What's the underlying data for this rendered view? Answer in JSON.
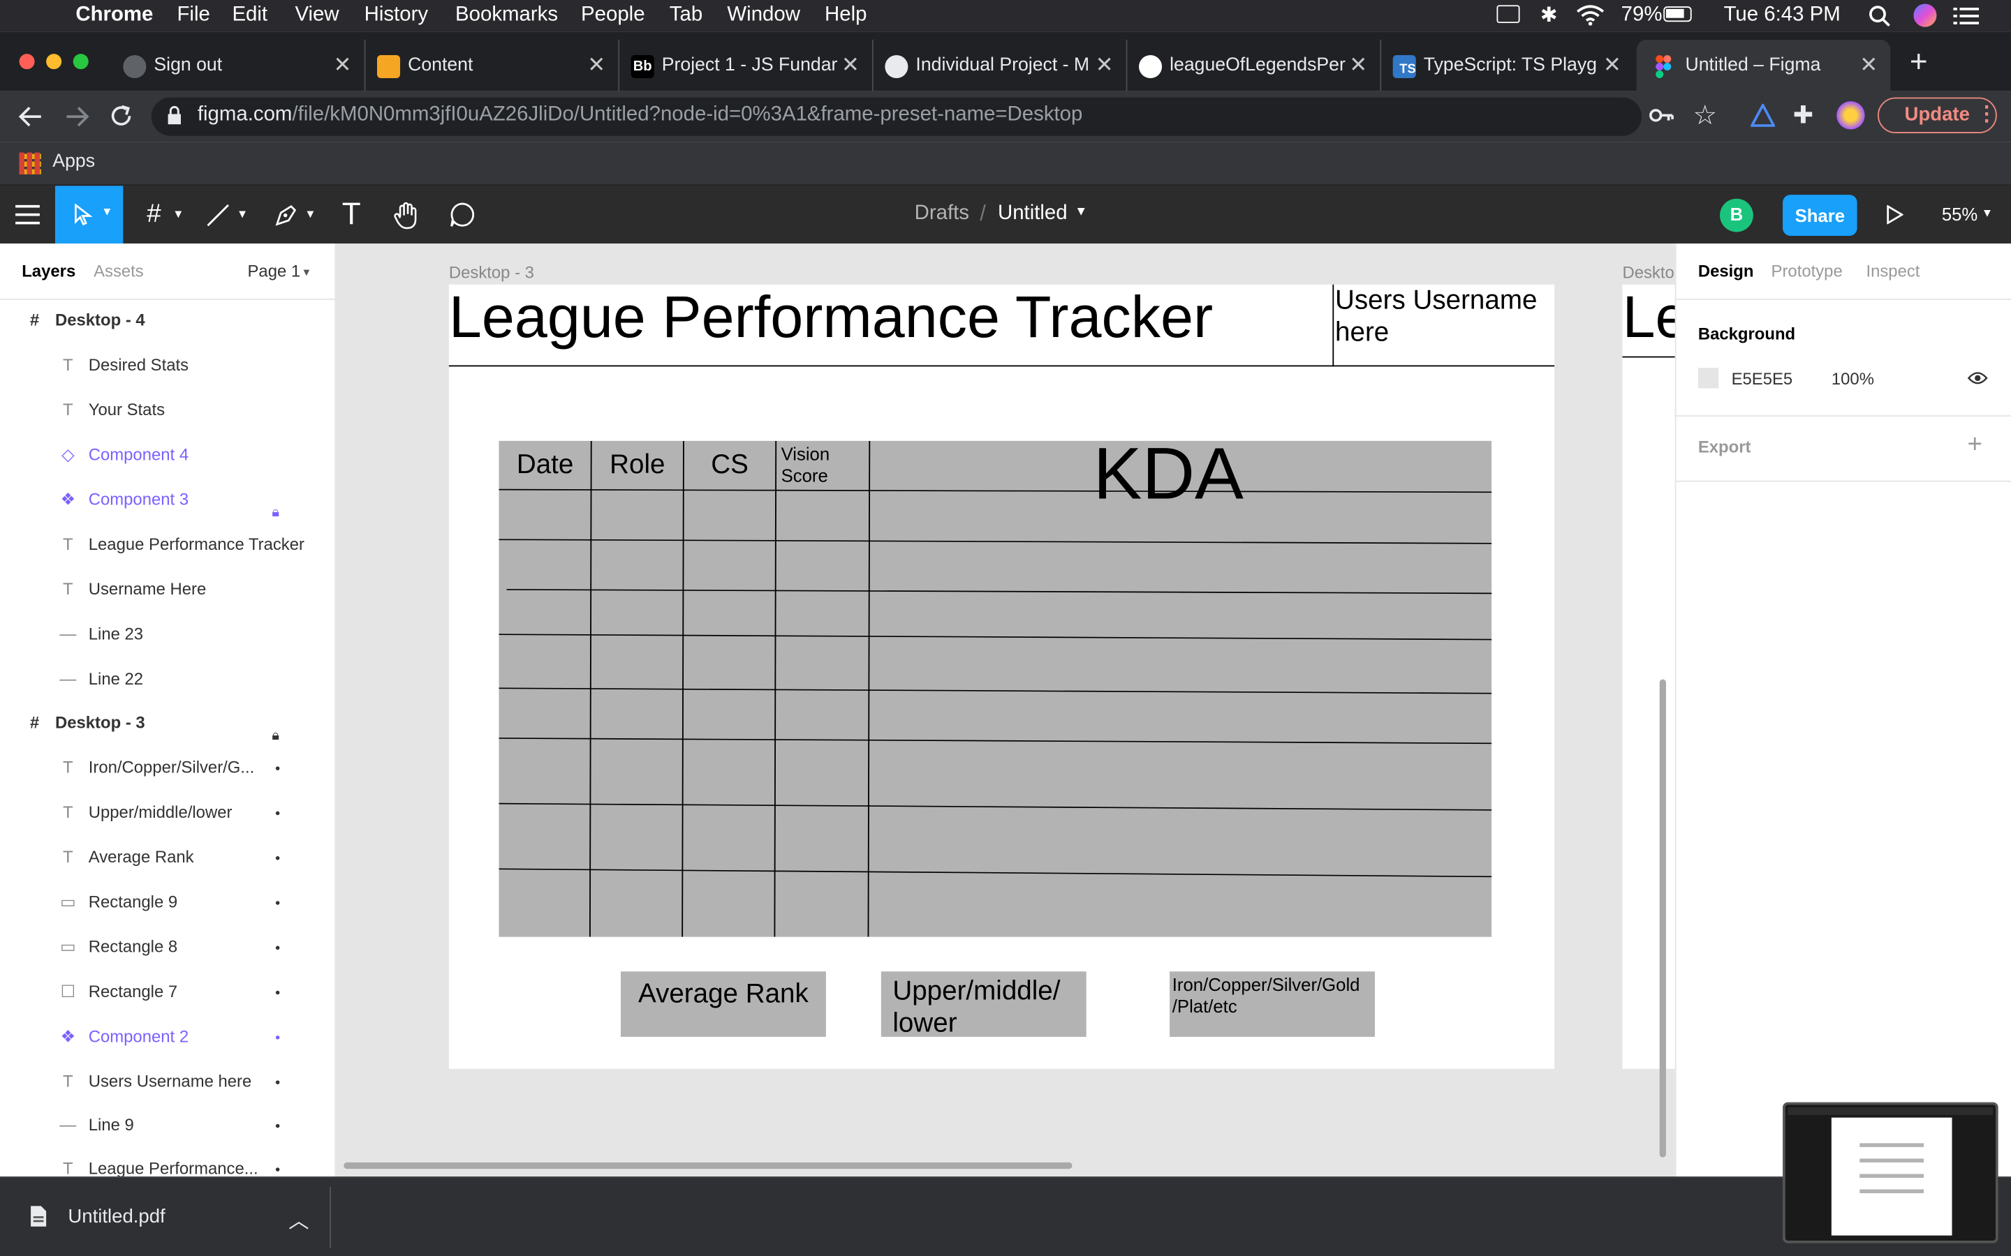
{
  "menubar": {
    "app": "Chrome",
    "items": [
      "File",
      "Edit",
      "View",
      "History",
      "Bookmarks",
      "People",
      "Tab",
      "Window",
      "Help"
    ],
    "battery": "79%",
    "clock": "Tue 6:43 PM"
  },
  "tabs": [
    {
      "label": "Sign out",
      "active": false
    },
    {
      "label": "Content",
      "active": false
    },
    {
      "label": "Project 1 - JS Fundar",
      "active": false
    },
    {
      "label": "Individual Project - M",
      "active": false
    },
    {
      "label": "leagueOfLegendsPer",
      "active": false
    },
    {
      "label": "TypeScript: TS Playg",
      "active": false
    },
    {
      "label": "Untitled – Figma",
      "active": true
    }
  ],
  "browser": {
    "url_host": "figma.com",
    "url_path": "/file/kM0N0mm3jfI0uAZ26JliDo/Untitled?node-id=0%3A1&frame-preset-name=Desktop",
    "update_label": "Update",
    "bookmark_apps": "Apps"
  },
  "figma_header": {
    "breadcrumb_parent": "Drafts",
    "breadcrumb_sep": "/",
    "file_name": "Untitled",
    "avatar_letter": "B",
    "share_label": "Share",
    "zoom": "55%"
  },
  "left_panel": {
    "tabs": [
      "Layers",
      "Assets"
    ],
    "page": "Page 1",
    "layers": [
      {
        "name": "Desktop - 4",
        "kind": "frame"
      },
      {
        "name": "Desired Stats",
        "kind": "text"
      },
      {
        "name": "Your Stats",
        "kind": "text"
      },
      {
        "name": "Component 4",
        "kind": "instance"
      },
      {
        "name": "Component 3",
        "kind": "component",
        "locked": true
      },
      {
        "name": "League Performance Tracker",
        "kind": "text"
      },
      {
        "name": "Username Here",
        "kind": "text"
      },
      {
        "name": "Line 23",
        "kind": "line"
      },
      {
        "name": "Line 22",
        "kind": "line"
      },
      {
        "name": "Desktop - 3",
        "kind": "frame",
        "locked": true
      },
      {
        "name": "Iron/Copper/Silver/G...",
        "kind": "text",
        "dot": true
      },
      {
        "name": "Upper/middle/lower",
        "kind": "text",
        "dot": true
      },
      {
        "name": "Average Rank",
        "kind": "text",
        "dot": true
      },
      {
        "name": "Rectangle 9",
        "kind": "rect",
        "dot": true
      },
      {
        "name": "Rectangle 8",
        "kind": "rect",
        "dot": true
      },
      {
        "name": "Rectangle 7",
        "kind": "rect-outline",
        "dot": true
      },
      {
        "name": "Component 2",
        "kind": "component",
        "dot": true
      },
      {
        "name": "Users Username here",
        "kind": "text",
        "dot": true
      },
      {
        "name": "Line 9",
        "kind": "line",
        "dot": true
      },
      {
        "name": "League Performance...",
        "kind": "text",
        "dot": true
      }
    ]
  },
  "canvas": {
    "frame_label": "Desktop - 3",
    "frame_label_right": "Deskto",
    "title": "League Performance Tracker",
    "title_partial": "Le",
    "username": "Users Username here",
    "table_headers": [
      "Date",
      "Role",
      "CS",
      "Vision Score",
      "KDA"
    ],
    "average_rank": "Average Rank",
    "position_label": "Upper/middle/ lower",
    "rank_tiers": "Iron/Copper/Silver/Gold /Plat/etc"
  },
  "right_panel": {
    "tabs": [
      "Design",
      "Prototype",
      "Inspect"
    ],
    "background_label": "Background",
    "bg_hex": "E5E5E5",
    "bg_opacity": "100%",
    "export_label": "Export"
  },
  "downloads": {
    "file": "Untitled.pdf"
  },
  "colors": {
    "figma_blue": "#18a0fb",
    "component_purple": "#7b61ff",
    "avatar_green": "#1bc47d",
    "table_gray": "#b3b3b3"
  }
}
